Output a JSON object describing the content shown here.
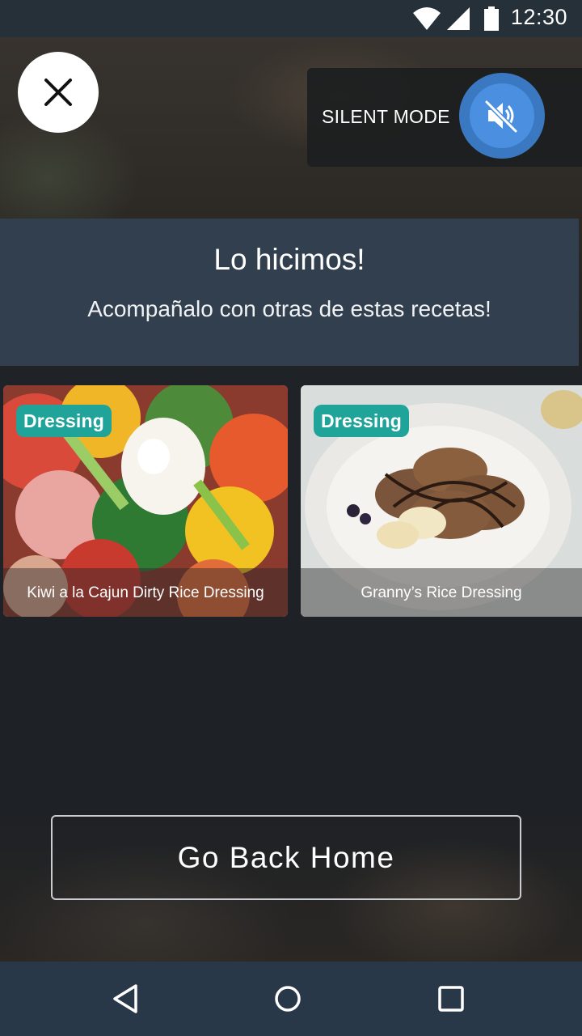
{
  "status_bar": {
    "time": "12:30",
    "icons": [
      "wifi-icon",
      "signal-icon",
      "battery-icon"
    ]
  },
  "top_controls": {
    "close_icon": "close-icon",
    "silent_mode_label": "SILENT MODE",
    "silent_icon": "volume-mute-icon"
  },
  "header": {
    "title": "Lo hicimos!",
    "subtitle": "Acompañalo con otras de estas recetas!"
  },
  "recipes": [
    {
      "badge": "Dressing",
      "title": "Kiwi a la Cajun Dirty Rice Dressing"
    },
    {
      "badge": "Dressing",
      "title": "Granny’s Rice Dressing"
    }
  ],
  "actions": {
    "home_button": "Go Back Home"
  },
  "nav": [
    "back-icon",
    "home-icon",
    "recents-icon"
  ],
  "colors": {
    "badge": "#20a49a",
    "header_card": "#323f4e",
    "silent_toggle": "#4a8fe0",
    "nav_bar": "#293848"
  }
}
